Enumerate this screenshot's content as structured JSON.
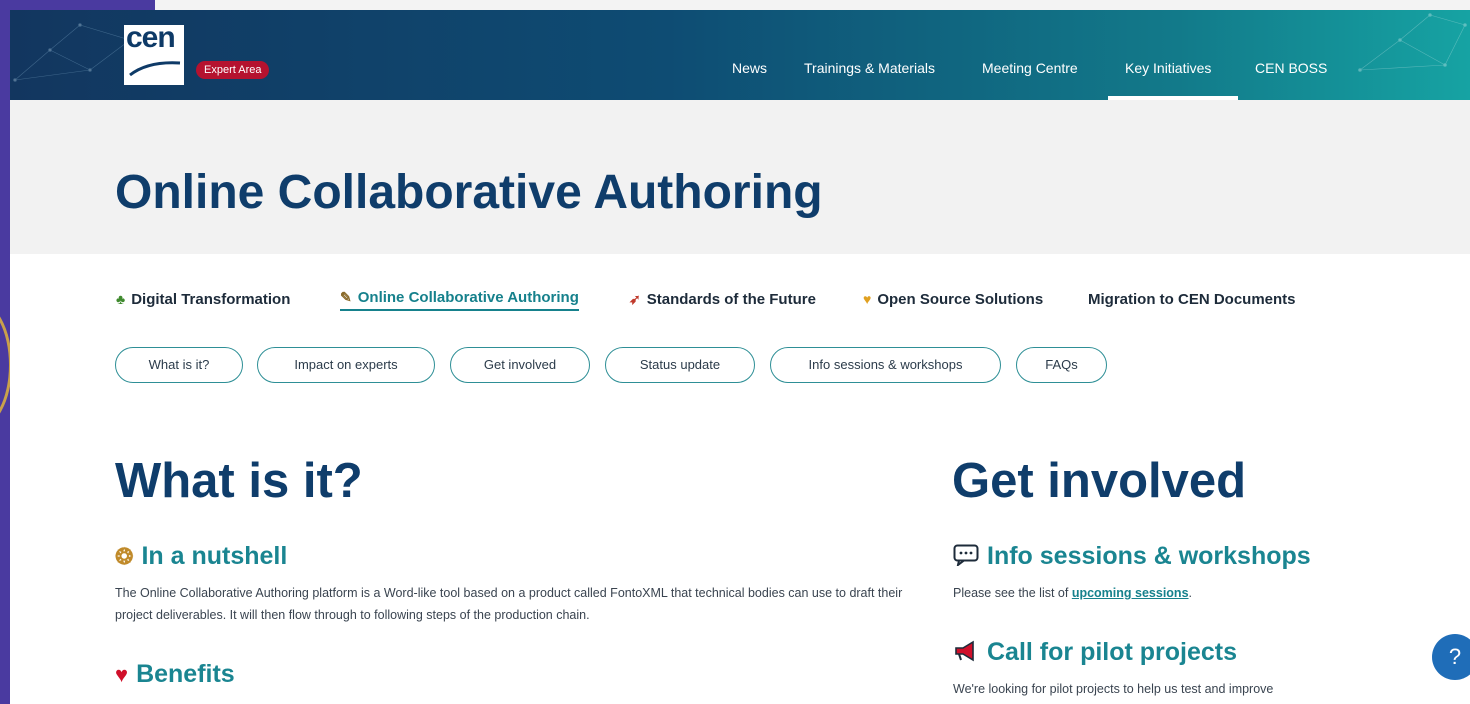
{
  "header": {
    "logo_text": "cen",
    "badge": "Expert Area",
    "nav": [
      {
        "label": "News"
      },
      {
        "label": "Trainings & Materials"
      },
      {
        "label": "Meeting Centre"
      },
      {
        "label": "Key Initiatives"
      },
      {
        "label": "CEN BOSS"
      }
    ],
    "active_nav": "Key Initiatives"
  },
  "page_title": "Online Collaborative Authoring",
  "tabs": [
    {
      "label": "Digital Transformation",
      "icon": "sprout-icon"
    },
    {
      "label": "Online Collaborative Authoring",
      "icon": "memo-icon",
      "active": true
    },
    {
      "label": "Standards of the Future",
      "icon": "rocket-icon"
    },
    {
      "label": "Open Source Solutions",
      "icon": "heart-hands-icon"
    },
    {
      "label": "Migration to CEN Documents",
      "icon": ""
    }
  ],
  "pills": [
    {
      "label": "What is it?"
    },
    {
      "label": "Impact on experts"
    },
    {
      "label": "Get involved"
    },
    {
      "label": "Status update"
    },
    {
      "label": "Info sessions & workshops"
    },
    {
      "label": "FAQs"
    }
  ],
  "left": {
    "heading": "What is it?",
    "nutshell": {
      "title": "In a nutshell",
      "text": "The Online Collaborative Authoring platform is a Word-like tool based on a product called FontoXML that technical bodies can use to draft their project deliverables. It will then flow through to following steps of the production chain."
    },
    "benefits": {
      "title": "Benefits"
    }
  },
  "right": {
    "heading": "Get involved",
    "sessions": {
      "title": "Info sessions & workshops",
      "text_before": "Please see the list of ",
      "link": "upcoming sessions",
      "text_after": "."
    },
    "pilot": {
      "title": "Call for pilot projects",
      "text": "We're looking for pilot projects to help us test and improve"
    }
  },
  "help": "?",
  "colors": {
    "brand_dark": "#0f3d6b",
    "teal": "#16818c",
    "badge_red": "#b5122f",
    "help_blue": "#1f6db8"
  }
}
